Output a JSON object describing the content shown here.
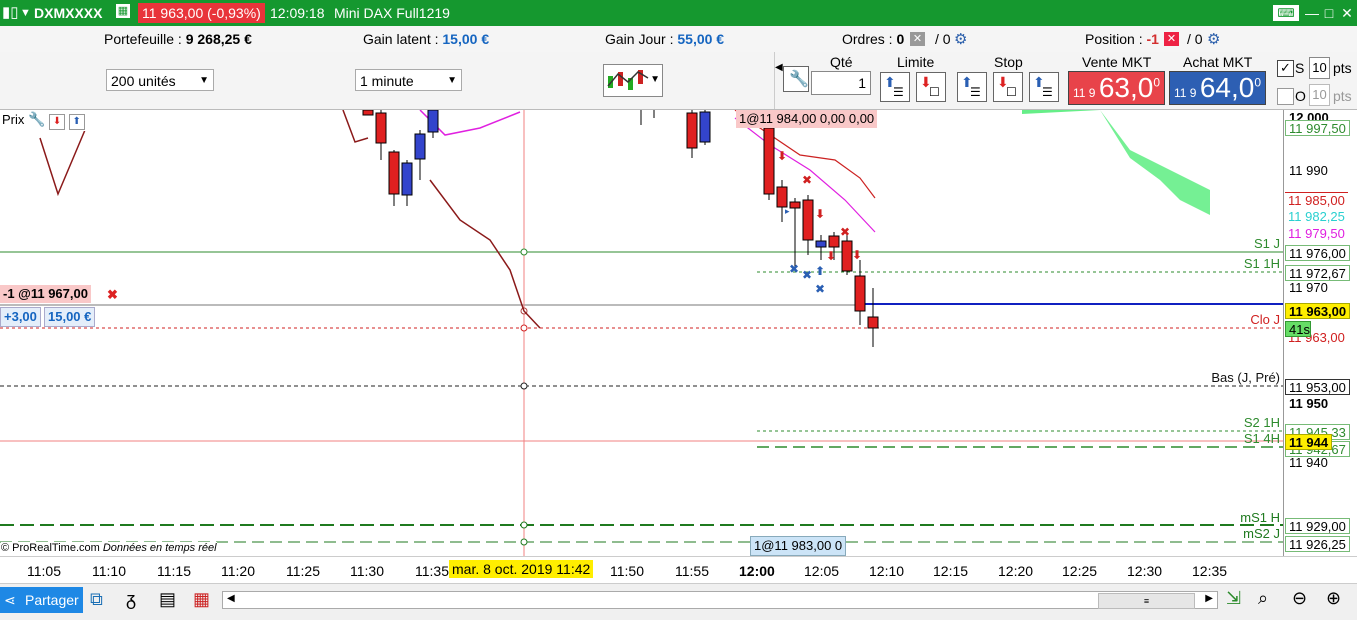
{
  "title": {
    "symbol": "DXMXXXX",
    "price_badge": "11 963,00 (-0,93%)",
    "time": "12:09:18",
    "instrument": "Mini DAX Full1219"
  },
  "info": {
    "portfolio_label": "Portefeuille :",
    "portfolio_value": "9 268,25 €",
    "gain_latent_label": "Gain latent :",
    "gain_latent_value": "15,00 €",
    "gain_jour_label": "Gain Jour :",
    "gain_jour_value": "55,00 €",
    "orders_label": "Ordres :",
    "orders_value": "0",
    "orders_total": "/ 0",
    "position_label": "Position :",
    "position_value": "-1",
    "position_total": "/ 0"
  },
  "toolbar": {
    "units_select": "200 unités",
    "interval_select": "1 minute",
    "qty_label": "Qté",
    "qty_value": "1",
    "limit_label": "Limite",
    "stop_label": "Stop",
    "sell_label": "Vente MKT",
    "sell_small": "11 9",
    "sell_big": "63,0",
    "sell_sup": "0",
    "buy_label": "Achat MKT",
    "buy_small": "11 9",
    "buy_big": "64,0",
    "buy_sup": "0",
    "s_label": "S",
    "s_pts": "10",
    "o_label": "O",
    "o_pts": "10",
    "pts": "pts"
  },
  "chart": {
    "prix_label": "Prix",
    "position_tag": "-1 @11 967,00",
    "pnl_points": "+3,00",
    "pnl_money": "15,00 €",
    "order_tag_top": "1@11 984,00",
    "order_tag_top_2": "0,00",
    "order_tag_top_3": "0,00",
    "order_tag_bottom": "1@11 983,00",
    "order_tag_bottom_2": "0",
    "copyright": "© ProRealTime.com",
    "realtime": "Données en temps réel",
    "levels": {
      "s1j": "S1 J",
      "s1h": "S1 1H",
      "cloj": "Clo J",
      "basj": "Bas (J, Pré)",
      "s2h": "S2 1H",
      "s14h": "S1 4H",
      "ms1h": "mS1 H",
      "ms2j": "mS2 J"
    }
  },
  "yaxis": {
    "ticks": [
      "12 000",
      "11 990",
      "11 970",
      "11 950",
      "11 940"
    ],
    "b_12000": "12 000",
    "b_11950": "11 950",
    "v_11997": "11 997,50",
    "v_11985": "11 985,00",
    "v_11982": "11 982,25",
    "v_11979": "11 979,50",
    "v_11976": "11 976,00",
    "v_11972": "11 972,67",
    "v_11963": "11 963,00",
    "v_11963b": "11 963,00",
    "timer": "41s",
    "v_11953": "11 953,00",
    "v_11945": "11 945,33",
    "v_11944": "11 944",
    "v_11942": "11 942,67",
    "v_11929": "11 929,00",
    "v_11926": "11 926,25"
  },
  "xaxis": {
    "labels": [
      "11:05",
      "11:10",
      "11:15",
      "11:20",
      "11:25",
      "11:30",
      "11:35",
      "11:50",
      "11:55",
      "12:00",
      "12:05",
      "12:10",
      "12:15",
      "12:20",
      "12:25",
      "12:30",
      "12:35"
    ],
    "cursor_date": "mar. 8 oct. 2019 11:42"
  },
  "bottom": {
    "share_label": "Partager"
  },
  "colors": {
    "title_green": "#15982f",
    "sell_red": "#e8434a",
    "buy_blue": "#2d5fb3",
    "candle_red": "#e02020",
    "candle_blue": "#3344cc"
  }
}
